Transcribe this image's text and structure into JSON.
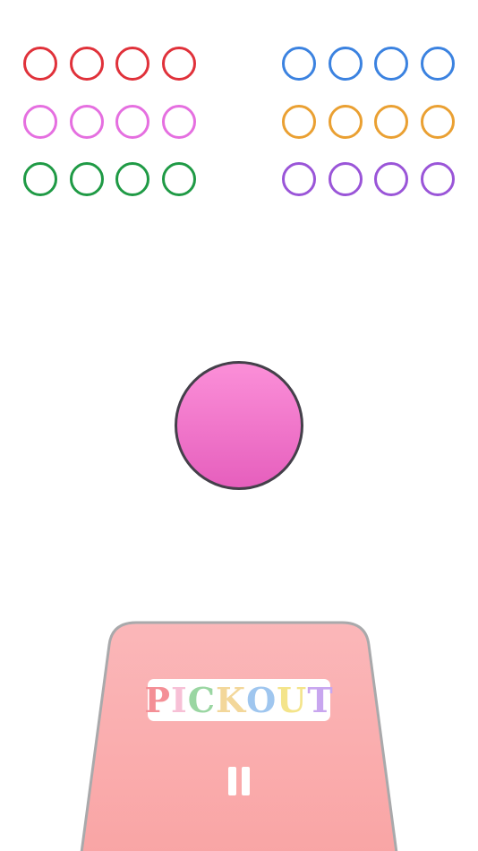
{
  "ring_grids": {
    "left": {
      "rows": [
        {
          "color": "#e0313a",
          "count": 4
        },
        {
          "color": "#e56fe0",
          "count": 4
        },
        {
          "color": "#1f9a45",
          "count": 4
        }
      ]
    },
    "right": {
      "rows": [
        {
          "color": "#3b82e0",
          "count": 4
        },
        {
          "color": "#eaa032",
          "count": 4
        },
        {
          "color": "#9a55d8",
          "count": 4
        }
      ]
    }
  },
  "ball": {
    "color_top": "#fb8fd8",
    "color_bottom": "#e65fbd",
    "outline": "#44404a"
  },
  "tray": {
    "fill_top": "#fbb7b9",
    "fill_bottom": "#f9a5a5",
    "stroke": "#a9a9ab"
  },
  "logo": {
    "text": "PICKOUT",
    "letter_colors": [
      "#f48f96",
      "#f7c0d6",
      "#9ad6a2",
      "#f3d79a",
      "#9fc6ef",
      "#f4e48a",
      "#c8a6ef"
    ]
  },
  "controls": {
    "pause_icon": "pause-icon"
  }
}
